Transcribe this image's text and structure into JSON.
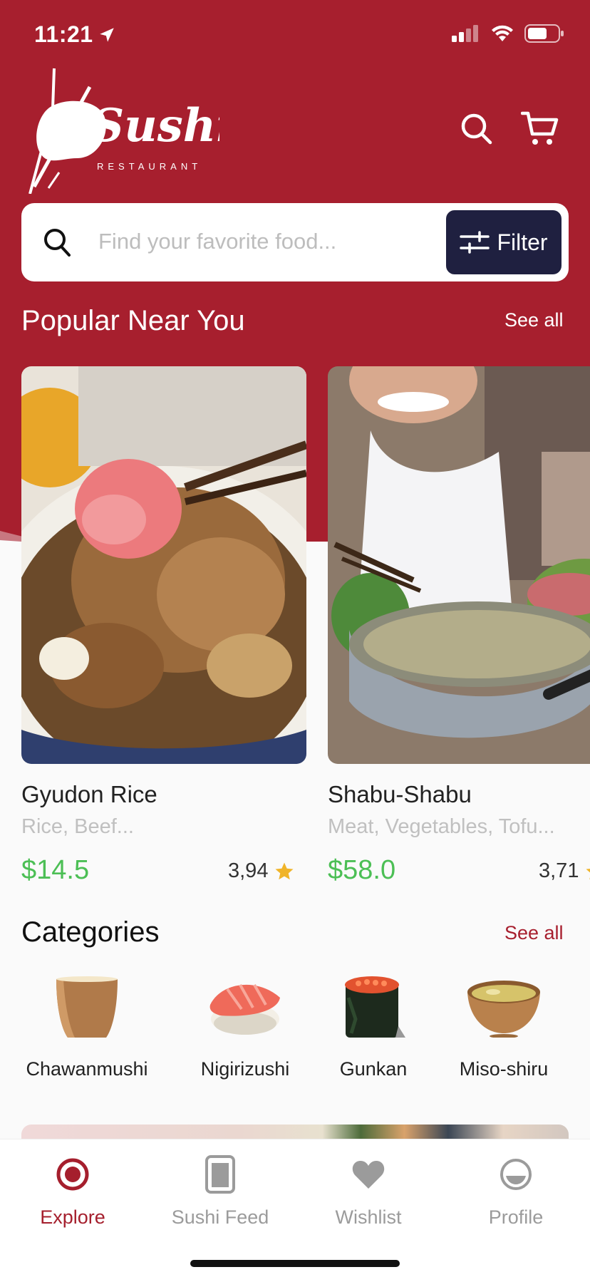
{
  "colors": {
    "brand_red": "#a71f2e",
    "filter_dark": "#1f2040",
    "price_green": "#4cbf55",
    "star": "#f0b429",
    "tab_inactive": "#9b9b9b"
  },
  "status_bar": {
    "time": "11:21",
    "icons": [
      "location-arrow-icon",
      "cellular-signal-icon",
      "wifi-icon",
      "battery-icon"
    ]
  },
  "header": {
    "logo_word": "Sushi",
    "logo_subtitle": "RESTAURANT",
    "icons": [
      "search-icon",
      "cart-icon"
    ]
  },
  "search": {
    "placeholder": "Find your favorite food...",
    "filter_label": "Filter"
  },
  "popular": {
    "title": "Popular Near You",
    "see_all": "See all",
    "items": [
      {
        "name": "Gyudon Rice",
        "ingredients": "Rice, Beef...",
        "price": "$14.5",
        "rating": "3,94"
      },
      {
        "name": "Shabu-Shabu",
        "ingredients": "Meat, Vegetables, Tofu...",
        "price": "$58.0",
        "rating": "3,71"
      }
    ]
  },
  "categories": {
    "title": "Categories",
    "see_all": "See all",
    "items": [
      {
        "label": "Chawanmushi"
      },
      {
        "label": "Nigirizushi"
      },
      {
        "label": "Gunkan"
      },
      {
        "label": "Miso-shiru"
      }
    ]
  },
  "tabbar": {
    "items": [
      {
        "label": "Explore",
        "icon": "explore-target-icon",
        "active": true
      },
      {
        "label": "Sushi Feed",
        "icon": "feed-card-icon",
        "active": false
      },
      {
        "label": "Wishlist",
        "icon": "heart-icon",
        "active": false
      },
      {
        "label": "Profile",
        "icon": "profile-icon",
        "active": false
      }
    ]
  }
}
